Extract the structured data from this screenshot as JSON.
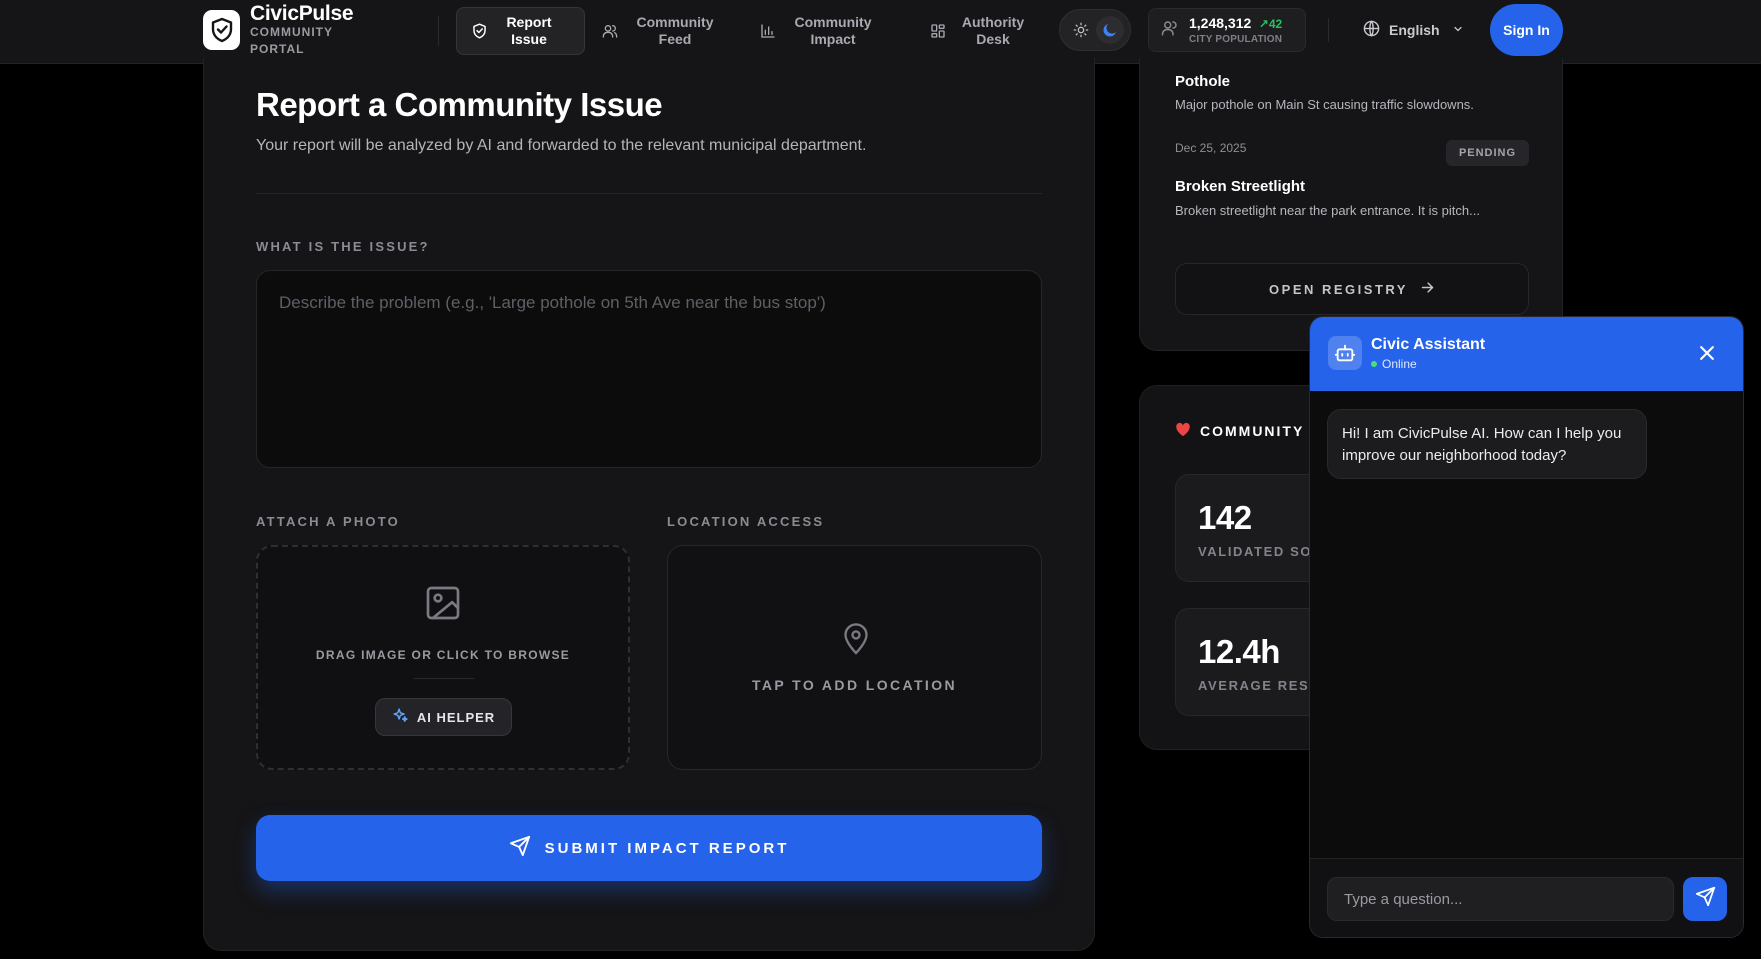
{
  "brand": {
    "name": "CivicPulse",
    "subtitle": "COMMUNITY PORTAL"
  },
  "nav": {
    "items": [
      {
        "label": "Report Issue",
        "icon": "shield-icon",
        "active": true
      },
      {
        "label": "Community Feed",
        "icon": "users-icon",
        "active": false
      },
      {
        "label": "Community Impact",
        "icon": "bar-chart-icon",
        "active": false
      },
      {
        "label": "Authority Desk",
        "icon": "grid-icon",
        "active": false
      }
    ],
    "theme": {
      "light_icon": "sun-icon",
      "dark_icon": "moon-icon",
      "selected": "dark"
    },
    "population": {
      "value": "1,248,312",
      "delta": "42",
      "label": "CITY POPULATION"
    },
    "language": "English",
    "sign_in": "Sign In"
  },
  "report": {
    "title": "Report a Community Issue",
    "subtitle": "Your report will be analyzed by AI and forwarded to the relevant municipal department.",
    "issue_label": "WHAT IS THE ISSUE?",
    "issue_placeholder": "Describe the problem (e.g., 'Large pothole on 5th Ave near the bus stop')",
    "photo_label": "ATTACH A PHOTO",
    "photo_hint": "DRAG IMAGE OR CLICK TO BROWSE",
    "ai_helper": "AI HELPER",
    "location_label": "LOCATION ACCESS",
    "location_hint": "TAP TO ADD LOCATION",
    "submit": "SUBMIT IMPACT REPORT"
  },
  "registry": {
    "items": [
      {
        "title": "Pothole",
        "description": "Major pothole on Main St causing traffic slowdowns."
      },
      {
        "date": "Dec 25, 2025",
        "status": "PENDING",
        "title": "Broken Streetlight",
        "description": "Broken streetlight near the park entrance. It is pitch..."
      }
    ],
    "open_button": "OPEN REGISTRY"
  },
  "stats": {
    "heading": "COMMUNITY",
    "tiles": [
      {
        "value": "142",
        "label": "VALIDATED SOL"
      },
      {
        "value": "12.4h",
        "label": "AVERAGE RESP"
      }
    ]
  },
  "chat": {
    "title": "Civic Assistant",
    "status": "Online",
    "messages": [
      {
        "from": "bot",
        "text": "Hi! I am CivicPulse AI. How can I help you improve our neighborhood today?"
      }
    ],
    "input_placeholder": "Type a question..."
  },
  "colors": {
    "accent": "#2563eb",
    "background": "#000000",
    "panel": "#151517",
    "success": "#22c55e",
    "heart": "#ef4444"
  }
}
